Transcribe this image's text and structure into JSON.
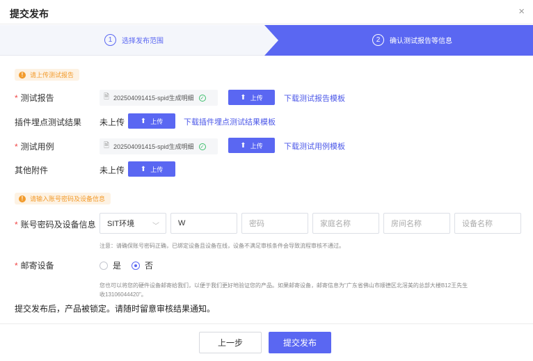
{
  "dialog": {
    "title": "提交发布",
    "close_icon": "×"
  },
  "steps": [
    {
      "num": "1",
      "label": "选择发布范围"
    },
    {
      "num": "2",
      "label": "确认测试报告等信息"
    }
  ],
  "section_report": {
    "notice": "请上传测试报告"
  },
  "fields": {
    "test_report": {
      "label": "测试报告",
      "file_name": "202504091415-spid生成明细",
      "upload_label": "上传",
      "template_link": "下载测试报告模板"
    },
    "plugin_result": {
      "label": "插件埋点测试结果",
      "status": "未上传",
      "upload_label": "上传",
      "template_link": "下载插件埋点测试结果模板"
    },
    "test_case": {
      "label": "测试用例",
      "file_name": "202504091415-spid生成明细",
      "upload_label": "上传",
      "template_link": "下载测试用例模板"
    },
    "other_attachments": {
      "label": "其他附件",
      "status": "未上传",
      "upload_label": "上传"
    }
  },
  "section_account": {
    "notice": "请输入账号密码及设备信息"
  },
  "account": {
    "label": "账号密码及设备信息",
    "env_value": "SIT环境",
    "account_value": "W",
    "password_placeholder": "密码",
    "family_placeholder": "家庭名称",
    "room_placeholder": "房间名称",
    "device_placeholder": "设备名称",
    "hint": "注意：请确保账号密码正确，已绑定设备且设备在线，设备不满足审核条件会导致流程审核不通过。"
  },
  "mail": {
    "label": "邮寄设备",
    "option_yes": "是",
    "option_no": "否",
    "selected": "否",
    "hint_line1": "您也可以将您的硬件设备邮寄给我们，以便于我们更好地验证您的产品。如果邮寄设备，邮寄信息为\"广东省佛山市顺德区北滘美的总部大楼B12王先生",
    "hint_line2": "收13106044420\"。"
  },
  "lock_note": "提交发布后，产品被锁定。请随时留意审核结果通知。",
  "footer": {
    "prev_label": "上一步",
    "submit_label": "提交发布"
  },
  "colors": {
    "accent": "#5a67f2",
    "warning": "#f29b2c",
    "required": "#f04646",
    "success": "#3cbf6b"
  },
  "icons": {
    "upload": "upload-icon",
    "doc": "document-icon",
    "check": "check-circle-icon",
    "warn": "warning-icon",
    "chevron": "chevron-down-icon",
    "close": "close-icon"
  }
}
